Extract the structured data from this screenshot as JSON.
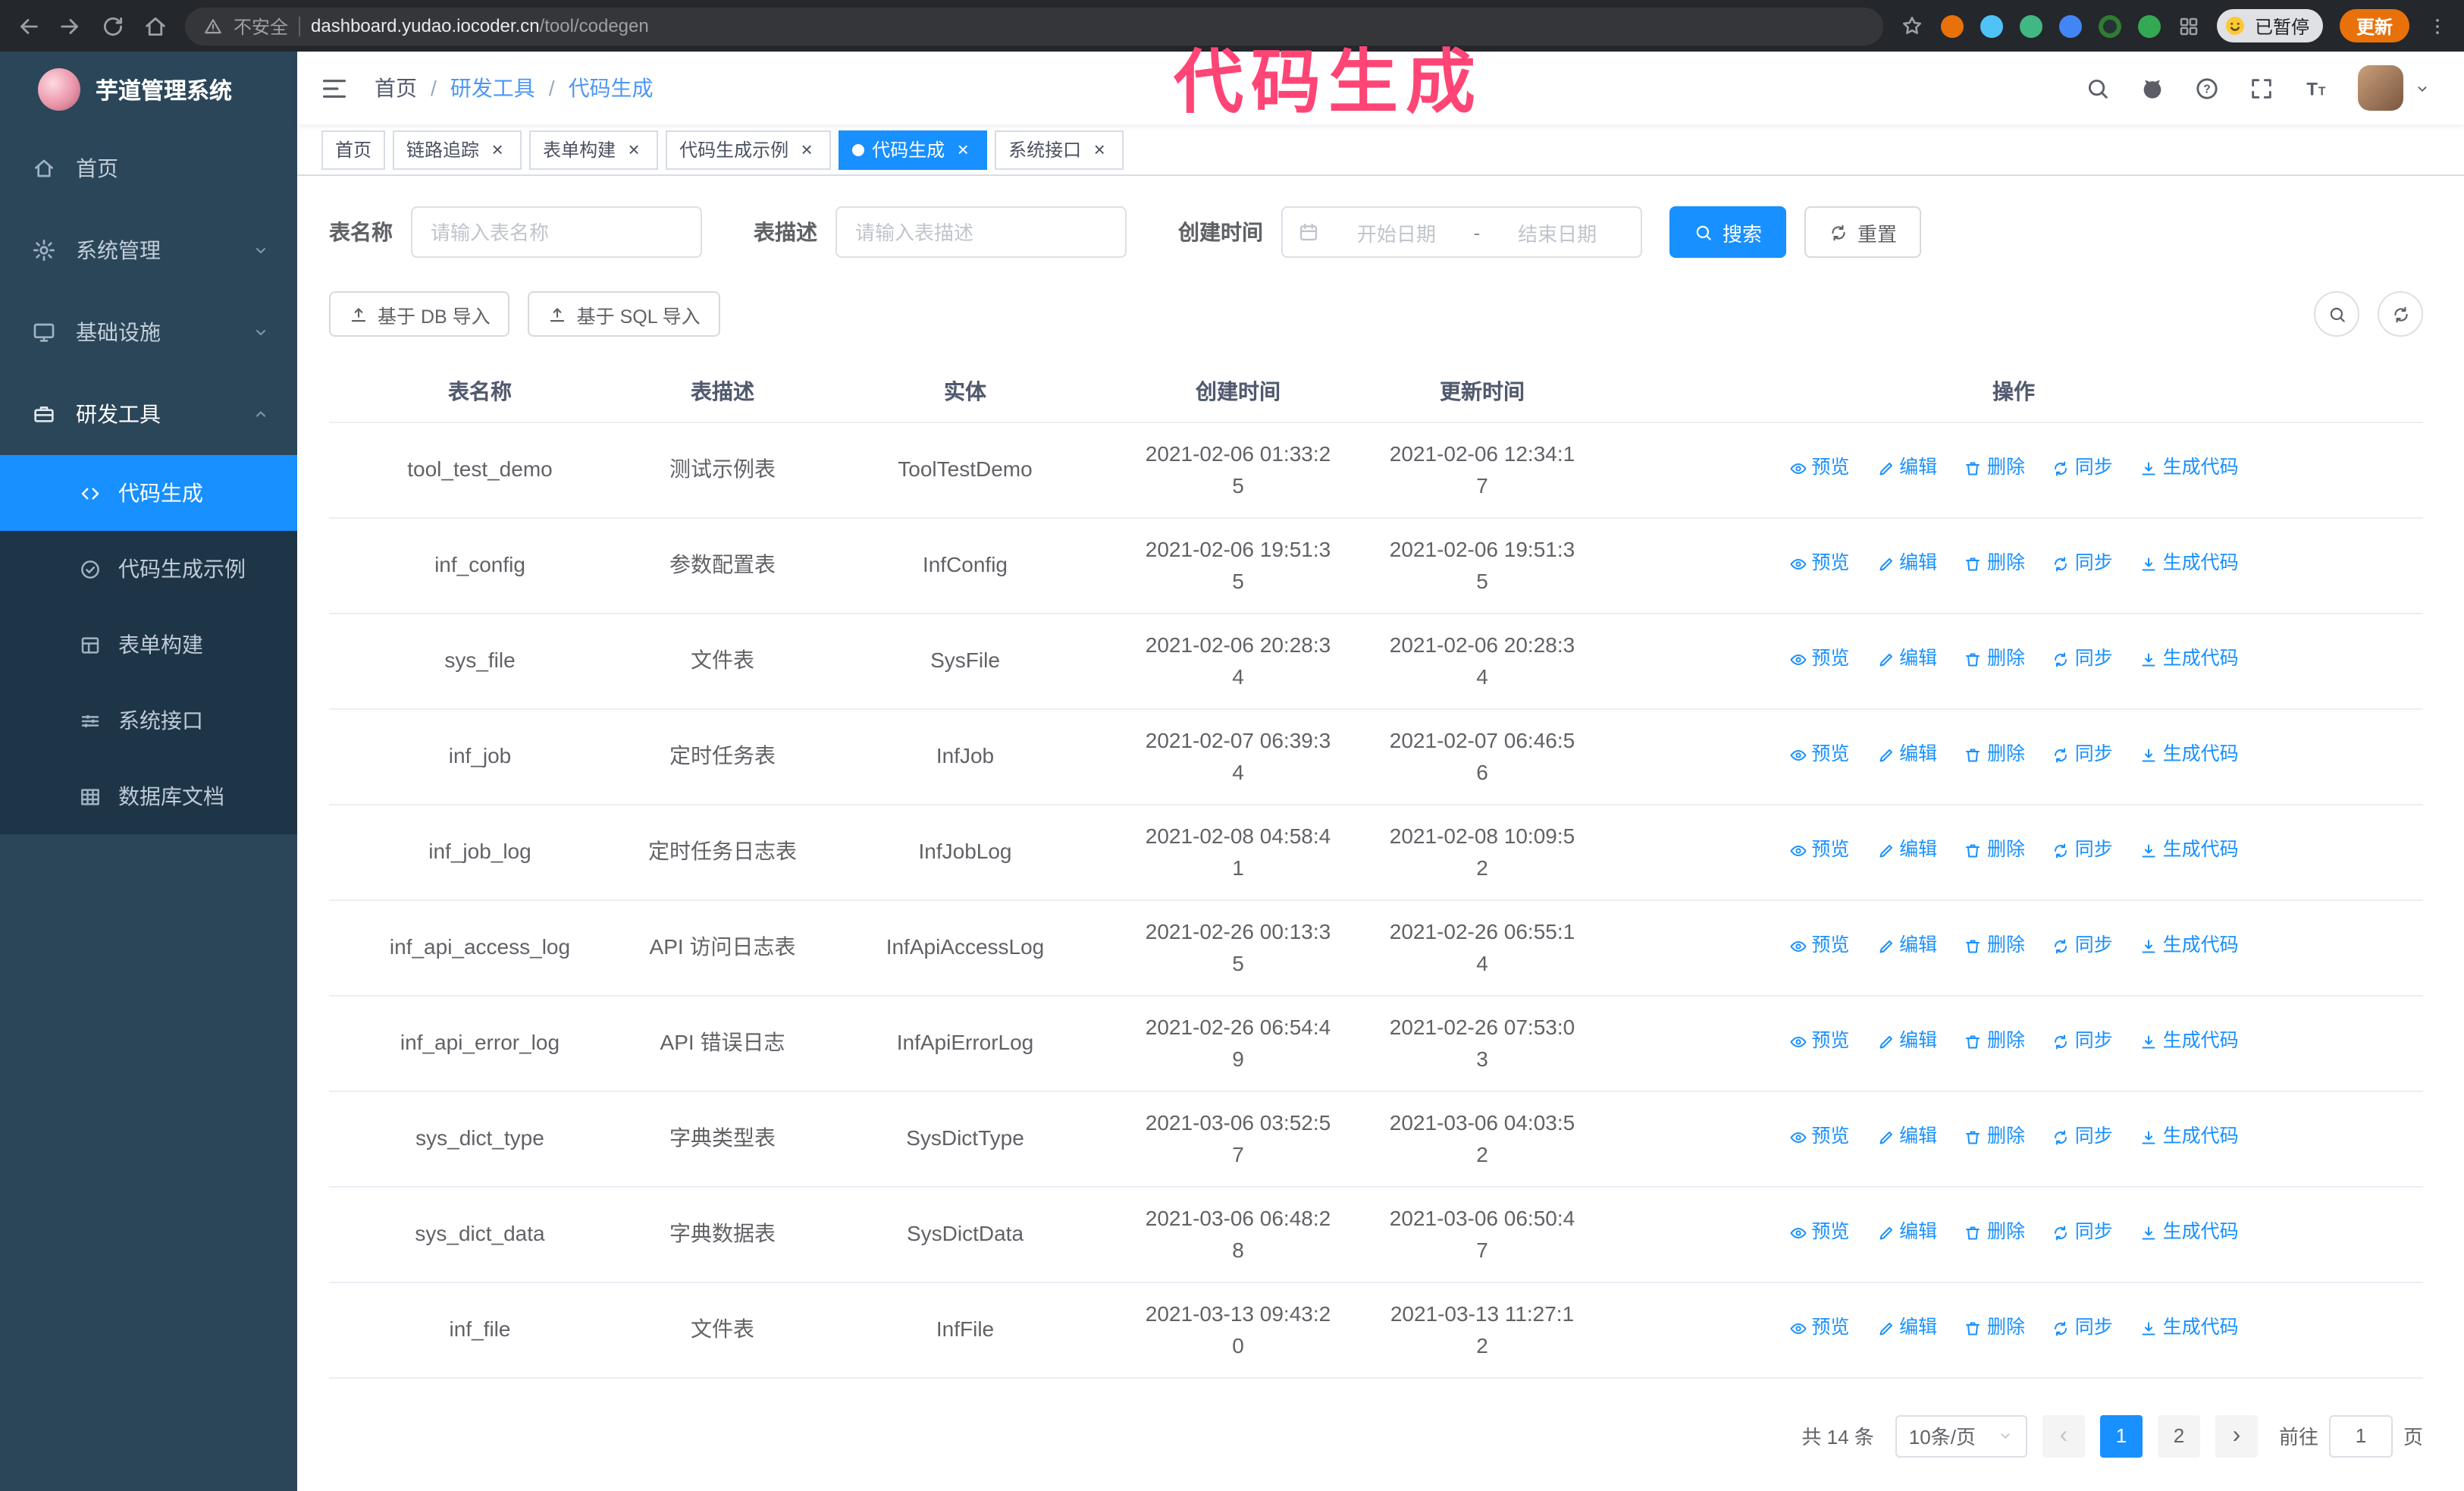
{
  "browser": {
    "security_label": "不安全",
    "url_host": "dashboard.yudao.iocoder.cn",
    "url_path": "/tool/codegen",
    "paused_badge": "已暂停",
    "update_button": "更新"
  },
  "annotation": {
    "text": "代码生成",
    "color": "#ff4575"
  },
  "colors": {
    "accent": "#1890ff",
    "sidebar_bg": "#2b4659",
    "submenu_bg": "#1e3547",
    "annotation_pink": "#ff4575"
  },
  "icons": {
    "address_security": "warning-triangle",
    "search": "magnifier",
    "github": "octocat-circle",
    "help": "question-circle",
    "fullscreen": "expand-corners",
    "font_size": "double-T",
    "menu_toggle": "hamburger-lines",
    "date_picker": "calendar",
    "preview": "eye",
    "edit": "pencil",
    "delete": "trash",
    "sync": "circular-arrows",
    "generate": "download-arrow",
    "import": "upload-arrow"
  },
  "sidebar": {
    "logo_title": "芋道管理系统",
    "items": [
      {
        "label": "首页"
      },
      {
        "label": "系统管理"
      },
      {
        "label": "基础设施"
      },
      {
        "label": "研发工具"
      }
    ],
    "submenu": [
      {
        "label": "代码生成"
      },
      {
        "label": "代码生成示例"
      },
      {
        "label": "表单构建"
      },
      {
        "label": "系统接口"
      },
      {
        "label": "数据库文档"
      }
    ]
  },
  "header": {
    "breadcrumb": [
      "首页",
      "研发工具",
      "代码生成"
    ]
  },
  "tabs": [
    {
      "label": "首页"
    },
    {
      "label": "链路追踪"
    },
    {
      "label": "表单构建"
    },
    {
      "label": "代码生成示例"
    },
    {
      "label": "代码生成"
    },
    {
      "label": "系统接口"
    }
  ],
  "filters": {
    "table_name_label": "表名称",
    "table_name_placeholder": "请输入表名称",
    "table_desc_label": "表描述",
    "table_desc_placeholder": "请输入表描述",
    "create_time_label": "创建时间",
    "date_start_placeholder": "开始日期",
    "date_separator": "-",
    "date_end_placeholder": "结束日期",
    "search_button": "搜索",
    "reset_button": "重置"
  },
  "toolbar": {
    "import_db": "基于 DB 导入",
    "import_sql": "基于 SQL 导入"
  },
  "table": {
    "columns": [
      "表名称",
      "表描述",
      "实体",
      "创建时间",
      "更新时间",
      "操作"
    ],
    "actions": [
      "预览",
      "编辑",
      "删除",
      "同步",
      "生成代码"
    ],
    "rows": [
      {
        "name": "tool_test_demo",
        "desc": "测试示例表",
        "entity": "ToolTestDemo",
        "created": "2021-02-06 01:33:25",
        "updated": "2021-02-06 12:34:17"
      },
      {
        "name": "inf_config",
        "desc": "参数配置表",
        "entity": "InfConfig",
        "created": "2021-02-06 19:51:35",
        "updated": "2021-02-06 19:51:35"
      },
      {
        "name": "sys_file",
        "desc": "文件表",
        "entity": "SysFile",
        "created": "2021-02-06 20:28:34",
        "updated": "2021-02-06 20:28:34"
      },
      {
        "name": "inf_job",
        "desc": "定时任务表",
        "entity": "InfJob",
        "created": "2021-02-07 06:39:34",
        "updated": "2021-02-07 06:46:56"
      },
      {
        "name": "inf_job_log",
        "desc": "定时任务日志表",
        "entity": "InfJobLog",
        "created": "2021-02-08 04:58:41",
        "updated": "2021-02-08 10:09:52"
      },
      {
        "name": "inf_api_access_log",
        "desc": "API 访问日志表",
        "entity": "InfApiAccessLog",
        "created": "2021-02-26 00:13:35",
        "updated": "2021-02-26 06:55:14"
      },
      {
        "name": "inf_api_error_log",
        "desc": "API 错误日志",
        "entity": "InfApiErrorLog",
        "created": "2021-02-26 06:54:49",
        "updated": "2021-02-26 07:53:03"
      },
      {
        "name": "sys_dict_type",
        "desc": "字典类型表",
        "entity": "SysDictType",
        "created": "2021-03-06 03:52:57",
        "updated": "2021-03-06 04:03:52"
      },
      {
        "name": "sys_dict_data",
        "desc": "字典数据表",
        "entity": "SysDictData",
        "created": "2021-03-06 06:48:28",
        "updated": "2021-03-06 06:50:47"
      },
      {
        "name": "inf_file",
        "desc": "文件表",
        "entity": "InfFile",
        "created": "2021-03-13 09:43:20",
        "updated": "2021-03-13 11:27:12"
      }
    ]
  },
  "pagination": {
    "total_text": "共 14 条",
    "page_size": "10条/页",
    "pages": [
      "1",
      "2"
    ],
    "goto_label": "前往",
    "goto_value": "1",
    "goto_suffix": "页"
  }
}
